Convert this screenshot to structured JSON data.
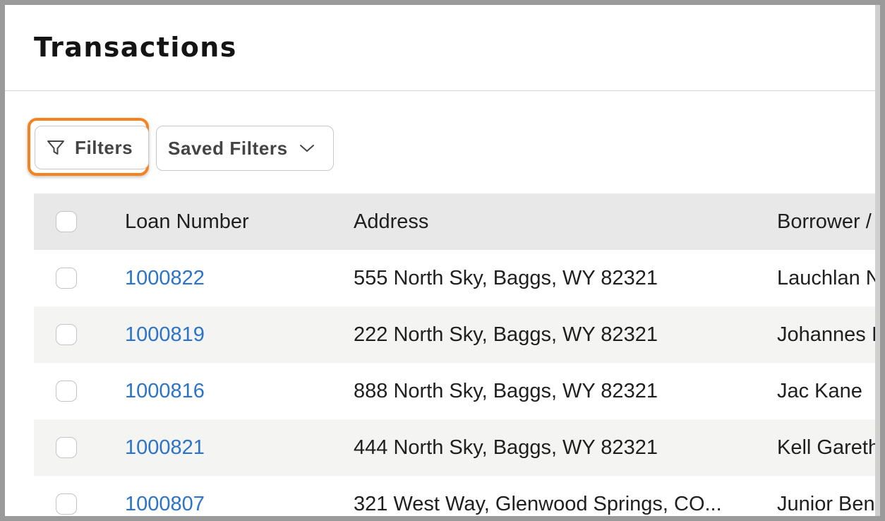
{
  "page": {
    "title": "Transactions"
  },
  "toolbar": {
    "filters_label": "Filters",
    "saved_filters_label": "Saved Filters",
    "highlight_color": "#f5821f",
    "filter_icon": "funnel-icon",
    "dropdown_icon": "chevron-down-icon"
  },
  "table": {
    "columns": [
      "Loan Number",
      "Address",
      "Borrower /"
    ],
    "rows": [
      {
        "loan": "1000822",
        "address": "555 North Sky, Baggs, WY 82321",
        "borrower": "Lauchlan N"
      },
      {
        "loan": "1000819",
        "address": "222 North Sky, Baggs, WY 82321",
        "borrower": "Johannes I"
      },
      {
        "loan": "1000816",
        "address": "888 North Sky, Baggs, WY 82321",
        "borrower": "Jac Kane"
      },
      {
        "loan": "1000821",
        "address": "444 North Sky, Baggs, WY 82321",
        "borrower": "Kell Gareth"
      },
      {
        "loan": "1000807",
        "address": "321 West Way, Glenwood Springs, CO...",
        "borrower": "Junior Ben"
      }
    ]
  },
  "colors": {
    "link": "#2b74c9",
    "header_bg": "#e8e8e8",
    "alt_row_bg": "#f4f4f3"
  }
}
